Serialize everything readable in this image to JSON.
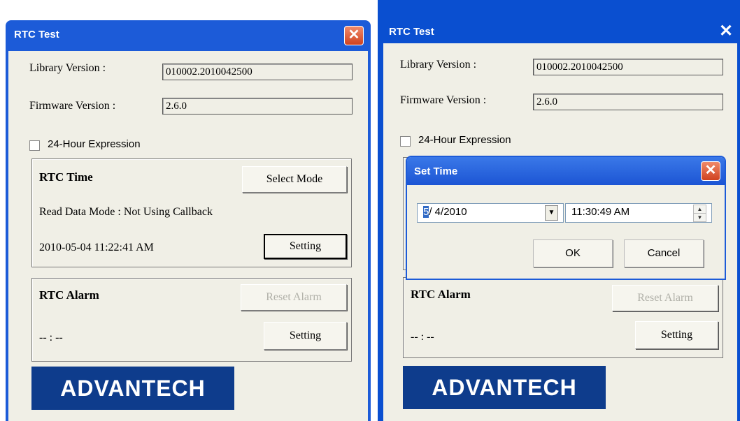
{
  "left_window": {
    "title": "RTC Test",
    "close_glyph": "✕",
    "library_label": "Library Version :",
    "library_value": "010002.2010042500",
    "firmware_label": "Firmware Version :",
    "firmware_value": "2.6.0",
    "checkbox_24h_label": "24-Hour Expression",
    "rtc_time": {
      "title": "RTC Time",
      "select_mode_label": "Select Mode",
      "read_mode_text": "Read Data Mode : Not Using Callback",
      "datetime_text": "2010-05-04 11:22:41 AM",
      "setting_label": "Setting"
    },
    "rtc_alarm": {
      "title": "RTC Alarm",
      "reset_label": "Reset Alarm",
      "time_text": "-- : --",
      "setting_label": "Setting"
    },
    "logo_text": "ADVANTECH"
  },
  "right_window": {
    "title": "RTC Test",
    "close_glyph": "✕",
    "library_label": "Library Version :",
    "library_value": "010002.2010042500",
    "firmware_label": "Firmware Version :",
    "firmware_value": "2.6.0",
    "checkbox_24h_label": "24-Hour Expression",
    "rtc_alarm": {
      "title": "RTC Alarm",
      "reset_label": "Reset Alarm",
      "time_text": "-- : --",
      "setting_label": "Setting"
    },
    "logo_text": "ADVANTECH"
  },
  "set_time_dialog": {
    "title": "Set Time",
    "close_glyph": "✕",
    "date_month": "5",
    "date_rest": "/  4/2010",
    "time_value": "11:30:49 AM",
    "ok_label": "OK",
    "cancel_label": "Cancel"
  },
  "colors": {
    "titlebar": "#1c5bd8",
    "client": "#f0efe6",
    "logo_bg": "#0e3c8c",
    "close_red": "#d0421f"
  }
}
